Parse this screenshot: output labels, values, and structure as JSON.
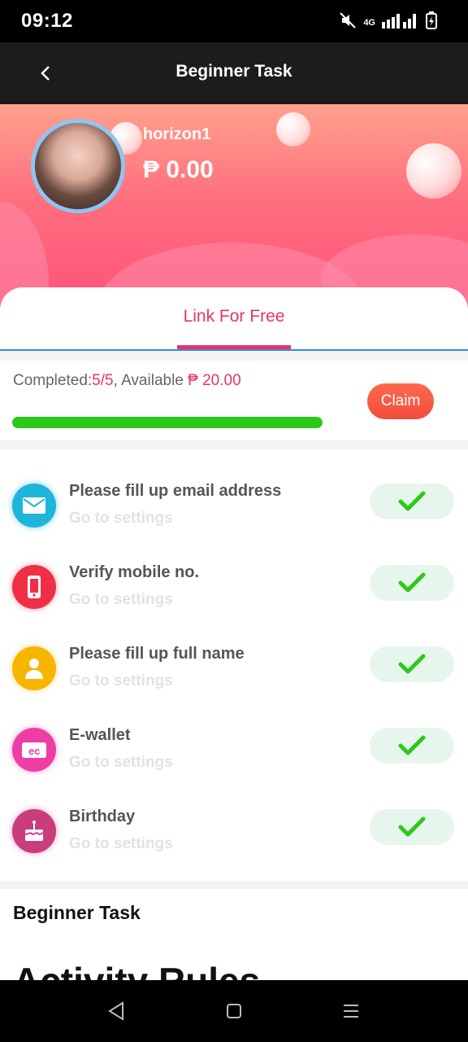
{
  "status_bar": {
    "time": "09:12",
    "network": "4G"
  },
  "header": {
    "title": "Beginner Task"
  },
  "profile": {
    "username": "horizon1",
    "balance": "₱ 0.00"
  },
  "tabs": [
    {
      "label": "Link For Free",
      "active": true
    }
  ],
  "progress": {
    "completed_label": "Completed:",
    "completed_value": "5/5",
    "available_label": ", Available ",
    "available_value": "₱ 20.00",
    "fraction": 1.0,
    "claim_label": "Claim"
  },
  "tasks": [
    {
      "title": "Please fill up email address",
      "subtitle": "Go to settings",
      "icon": "email-icon",
      "color": "#1fb5d8",
      "done": true
    },
    {
      "title": "Verify mobile no.",
      "subtitle": "Go to settings",
      "icon": "mobile-icon",
      "color": "#ef2f45",
      "done": true
    },
    {
      "title": "Please fill up full name",
      "subtitle": "Go to settings",
      "icon": "person-icon",
      "color": "#f7b500",
      "done": true
    },
    {
      "title": "E-wallet",
      "subtitle": "Go to settings",
      "icon": "wallet-icon",
      "color": "#ee3ea5",
      "done": true
    },
    {
      "title": "Birthday",
      "subtitle": "Go to settings",
      "icon": "cake-icon",
      "color": "#c93d7d",
      "done": true
    }
  ],
  "sections": {
    "beginner_task_title": "Beginner Task",
    "activity_rules_title": "Activity Rules"
  },
  "colors": {
    "accent": "#e8336a",
    "progress": "#2bc919",
    "claim": "#f24c3d",
    "check": "#2bc919"
  }
}
